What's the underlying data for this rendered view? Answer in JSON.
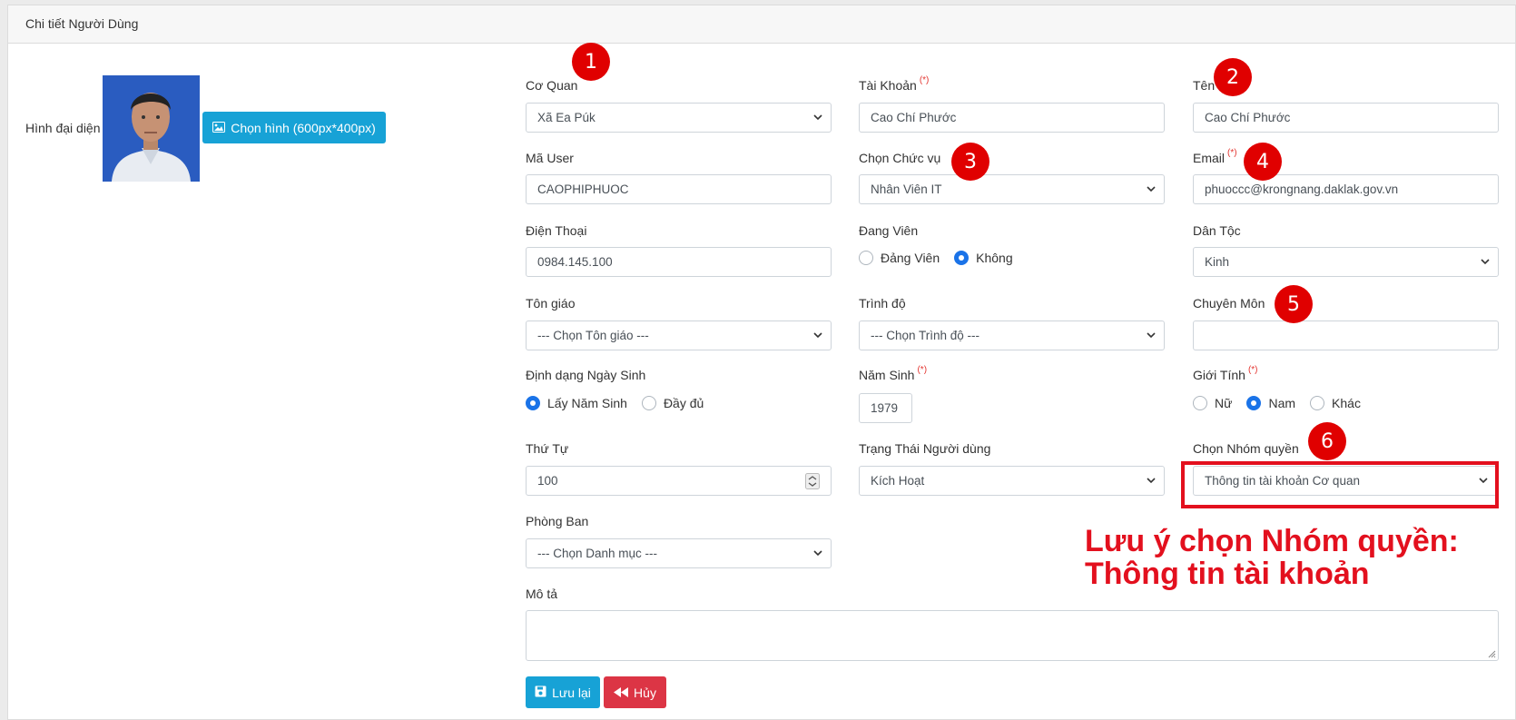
{
  "header": {
    "title": "Chi tiết Người Dùng"
  },
  "avatar": {
    "label": "Hình đại diện",
    "choose_button": "Chọn hình (600px*400px)"
  },
  "required_mark": "(*)",
  "fields": {
    "co_quan": {
      "label": "Cơ Quan",
      "value": "Xã Ea Púk"
    },
    "tai_khoan": {
      "label": "Tài Khoản",
      "value": "Cao Chí Phước"
    },
    "ten": {
      "label": "Tên",
      "value": "Cao Chí Phước"
    },
    "ma_user": {
      "label": "Mã User",
      "value": "CAOPHIPHUOC"
    },
    "chuc_vu": {
      "label": "Chọn Chức vụ",
      "value": "Nhân Viên IT"
    },
    "email": {
      "label": "Email",
      "value": "phuoccc@krongnang.daklak.gov.vn"
    },
    "dien_thoai": {
      "label": "Điện Thoại",
      "value": "0984.145.100"
    },
    "dang_vien": {
      "label": "Đang Viên",
      "options": [
        "Đảng Viên",
        "Không"
      ],
      "selected": "Không"
    },
    "dan_toc": {
      "label": "Dân Tộc",
      "value": "Kinh"
    },
    "ton_giao": {
      "label": "Tôn giáo",
      "value": "--- Chọn Tôn giáo ---"
    },
    "trinh_do": {
      "label": "Trình độ",
      "value": "--- Chọn Trình độ ---"
    },
    "chuyen_mon": {
      "label": "Chuyên Môn",
      "value": ""
    },
    "dinh_dang_ngay_sinh": {
      "label": "Định dạng Ngày Sinh",
      "options": [
        "Lấy Năm Sinh",
        "Đầy đủ"
      ],
      "selected": "Lấy Năm Sinh"
    },
    "nam_sinh": {
      "label": "Năm Sinh",
      "value": "1979"
    },
    "gioi_tinh": {
      "label": "Giới Tính",
      "options": [
        "Nữ",
        "Nam",
        "Khác"
      ],
      "selected": "Nam"
    },
    "thu_tu": {
      "label": "Thứ Tự",
      "value": "100"
    },
    "trang_thai": {
      "label": "Trạng Thái Người dùng",
      "value": "Kích Hoạt"
    },
    "nhom_quyen": {
      "label": "Chọn Nhóm quyền",
      "value": "Thông tin tài khoản Cơ quan"
    },
    "phong_ban": {
      "label": "Phòng Ban",
      "value": "--- Chọn Danh mục ---"
    },
    "mo_ta": {
      "label": "Mô tả",
      "value": ""
    }
  },
  "buttons": {
    "save": "Lưu lại",
    "cancel": "Hủy"
  },
  "annotations": {
    "badges": [
      "1",
      "2",
      "3",
      "4",
      "5",
      "6"
    ],
    "note_line1": "Lưu ý chọn Nhóm quyền:",
    "note_line2": "Thông tin tài khoản",
    "color": "#e3101e"
  },
  "colors": {
    "primary": "#17a2d6",
    "danger": "#dc3545",
    "radio_on": "#1a73e8"
  }
}
